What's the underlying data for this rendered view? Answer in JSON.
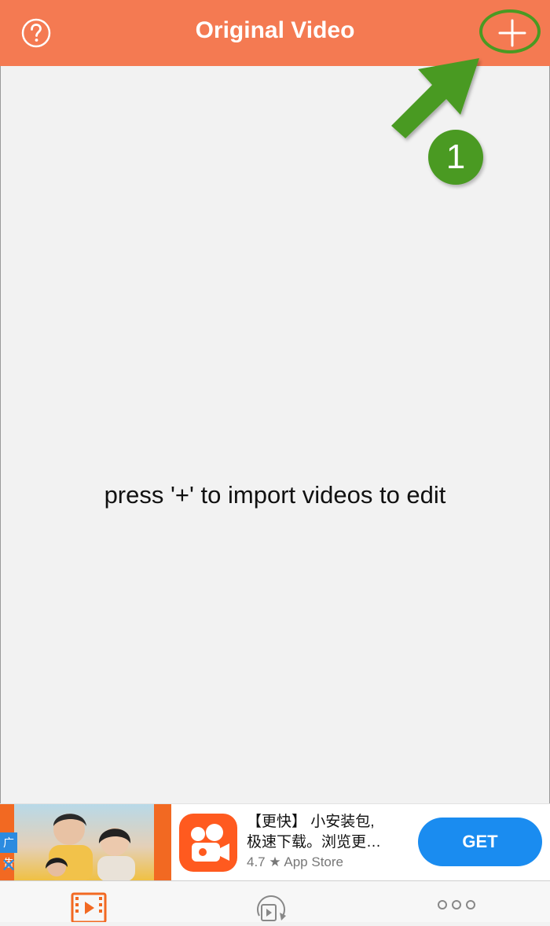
{
  "header": {
    "title": "Original Video",
    "help_icon": "question-circle-icon",
    "add_icon": "plus-icon",
    "bg_color": "#f47a52"
  },
  "annotation": {
    "step_number": "1",
    "color": "#4a9a22"
  },
  "main": {
    "empty_message": "press '+' to import videos to edit"
  },
  "ad": {
    "tag": "广告",
    "close_icon": "close-x-icon",
    "headline_line1": "【更快】 小安装包,",
    "headline_line2": "极速下载。浏览更…",
    "rating": "4.7 ★ App Store",
    "cta_label": "GET",
    "cta_color": "#1a8cf0"
  },
  "tabbar": {
    "tabs": [
      {
        "icon": "film-strip-icon",
        "active": true
      },
      {
        "icon": "video-rotate-icon",
        "active": false
      },
      {
        "icon": "more-dots-icon",
        "active": false
      }
    ],
    "active_color": "#f26922"
  }
}
